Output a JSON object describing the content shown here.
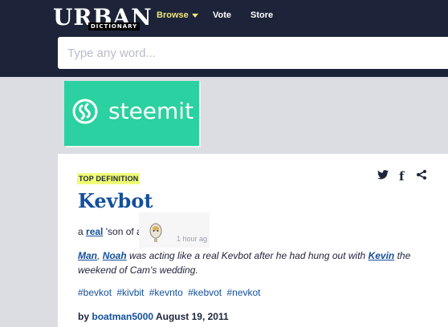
{
  "header": {
    "logo_word": "URBAN",
    "logo_sub": "DICTIONARY",
    "nav": {
      "browse": "Browse",
      "vote": "Vote",
      "store": "Store"
    },
    "search_placeholder": "Type any word..."
  },
  "ad": {
    "brand": "steemit",
    "color": "#2bd1a0"
  },
  "definition": {
    "badge": "TOP DEFINITION",
    "word": "Kevbot",
    "meaning": {
      "prefix": "a",
      "link": "real",
      "rest": "'son of a"
    },
    "timestamp": "1 hour ag",
    "example": {
      "link1": "Man",
      "sep": ",",
      "link2": "Noah",
      "middle": "was acting like a real Kevbot after he had hung out with",
      "link3": "Kevin",
      "end": "the weekend of Cam's wedding."
    },
    "tags": [
      "#bevkot",
      "#kivbit",
      "#kevnto",
      "#kebvot",
      "#nevkot"
    ],
    "author": {
      "by": "by",
      "name": "boatman5000",
      "date": "August 19, 2011"
    }
  },
  "share_icons": [
    "twitter-icon",
    "facebook-icon",
    "share-icon"
  ],
  "colors": {
    "nav_bg": "#1d2439",
    "accent_yellow": "#effd75",
    "link_blue": "#134f9e"
  }
}
